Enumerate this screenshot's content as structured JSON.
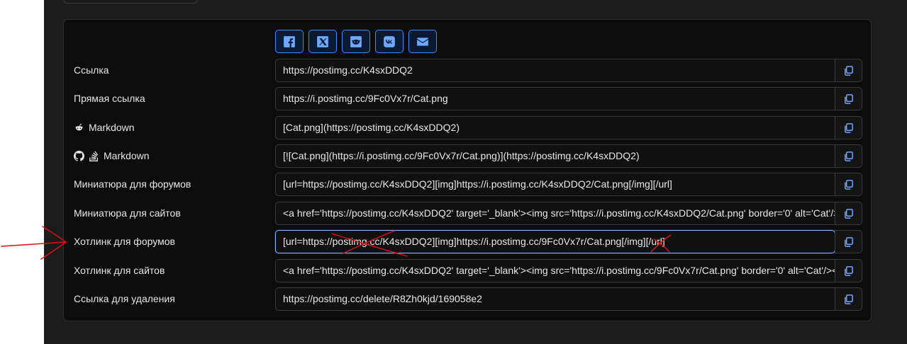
{
  "share_buttons": [
    {
      "name": "facebook-share-button",
      "icon": "facebook-icon"
    },
    {
      "name": "x-share-button",
      "icon": "x-icon"
    },
    {
      "name": "reddit-share-button",
      "icon": "reddit-icon"
    },
    {
      "name": "vk-share-button",
      "icon": "vk-icon"
    },
    {
      "name": "email-share-button",
      "icon": "envelope-icon"
    }
  ],
  "rows": [
    {
      "label": "Ссылка",
      "value": "https://postimg.cc/K4sxDDQ2"
    },
    {
      "label": "Прямая ссылка",
      "value": "https://i.postimg.cc/9Fc0Vx7r/Cat.png"
    },
    {
      "label": "Markdown",
      "icon": "reddit-icon",
      "value": "[Cat.png](https://postimg.cc/K4sxDDQ2)"
    },
    {
      "label": "Markdown",
      "icon": "github-stackoverflow-icons",
      "value": "[![Cat.png](https://i.postimg.cc/9Fc0Vx7r/Cat.png)](https://postimg.cc/K4sxDDQ2)"
    },
    {
      "label": "Миниатюра для форумов",
      "value": "[url=https://postimg.cc/K4sxDDQ2][img]https://i.postimg.cc/K4sxDDQ2/Cat.png[/img][/url]"
    },
    {
      "label": "Миниатюра для сайтов",
      "value": "<a href='https://postimg.cc/K4sxDDQ2' target='_blank'><img src='https://i.postimg.cc/K4sxDDQ2/Cat.png' border='0' alt='Cat'/></a>"
    },
    {
      "label": "Хотлинк для форумов",
      "value": "[url=https://postimg.cc/K4sxDDQ2][img]https://i.postimg.cc/9Fc0Vx7r/Cat.png[/img][/url]"
    },
    {
      "label": "Хотлинк для сайтов",
      "value": "<a href='https://postimg.cc/K4sxDDQ2' target='_blank'><img src='https://i.postimg.cc/9Fc0Vx7r/Cat.png' border='0' alt='Cat'/></a>"
    },
    {
      "label": "Ссылка для удаления",
      "value": "https://postimg.cc/delete/R8Zh0kjd/169058e2"
    }
  ],
  "colors": {
    "accent": "#3d8bfd",
    "annotation": "#e01010",
    "background": "#1b1b1c"
  }
}
